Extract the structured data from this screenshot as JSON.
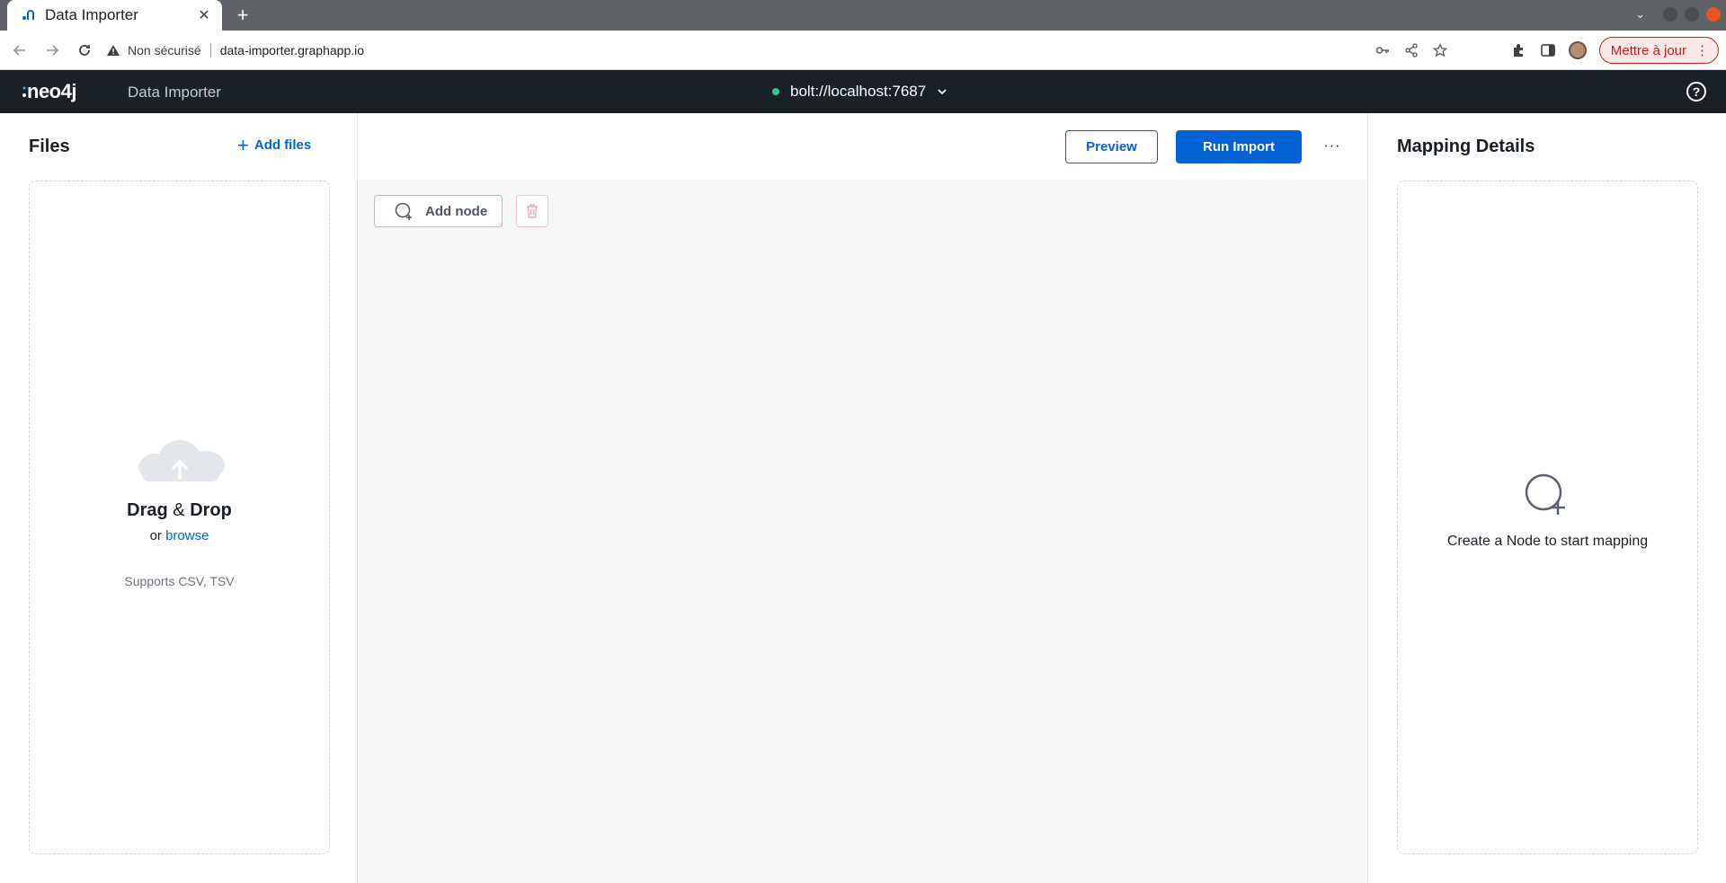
{
  "browser": {
    "tab_title": "Data Importer",
    "security_label": "Non sécurisé",
    "url": "data-importer.graphapp.io",
    "update_button": "Mettre à jour"
  },
  "app": {
    "logo_text": "neo4j",
    "name": "Data Importer",
    "connection": "bolt://localhost:7687",
    "connection_status_color": "#35c48a"
  },
  "files_panel": {
    "title": "Files",
    "add_files": "Add files",
    "dropzone": {
      "drag": "Drag",
      "amp": "&",
      "drop": "Drop",
      "or": "or",
      "browse": "browse",
      "supports": "Supports CSV, TSV"
    }
  },
  "center": {
    "preview": "Preview",
    "run_import": "Run Import",
    "more": "···",
    "add_node": "Add node"
  },
  "mapping_panel": {
    "title": "Mapping Details",
    "empty_text": "Create a Node to start mapping"
  },
  "colors": {
    "primary": "#0163d5",
    "appbar": "#18202a",
    "canvas": "#f5f6f8"
  }
}
